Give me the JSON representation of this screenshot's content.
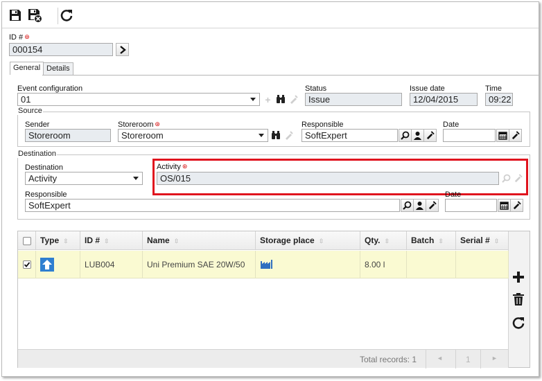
{
  "toolbar": {
    "save_icon": "save-icon",
    "save_close_icon": "save-and-close-icon",
    "refresh_icon": "refresh-icon"
  },
  "header": {
    "id_label": "ID #",
    "id_value": "000154"
  },
  "tabs": [
    {
      "label": "General",
      "active": true
    },
    {
      "label": "Details",
      "active": false
    }
  ],
  "event": {
    "config_label": "Event configuration",
    "config_value": "01",
    "status_label": "Status",
    "status_value": "Issue",
    "issue_date_label": "Issue date",
    "issue_date_value": "12/04/2015",
    "time_label": "Time",
    "time_value": "09:22"
  },
  "source": {
    "legend": "Source",
    "sender_label": "Sender",
    "sender_value": "Storeroom",
    "storeroom_label": "Storeroom",
    "storeroom_value": "Storeroom",
    "responsible_label": "Responsible",
    "responsible_value": "SoftExpert",
    "date_label": "Date",
    "date_value": ""
  },
  "destination": {
    "legend": "Destination",
    "dest_label": "Destination",
    "dest_value": "Activity",
    "activity_label": "Activity",
    "activity_value": "OS/015",
    "responsible_label": "Responsible",
    "responsible_value": "SoftExpert",
    "date_label": "Date",
    "date_value": ""
  },
  "grid": {
    "columns": [
      "Type",
      "ID #",
      "Name",
      "Storage place",
      "Qty.",
      "Batch",
      "Serial #"
    ],
    "rows": [
      {
        "checked": true,
        "type_icon": "inbound-type-icon",
        "id": "LUB004",
        "name": "Uni Premium SAE 20W/50",
        "storage_icon": "factory-icon",
        "qty": "8.00 l",
        "batch": "",
        "serial": ""
      }
    ],
    "footer": {
      "total_records": "Total records: 1",
      "prev": "◄",
      "page": "1",
      "next": "►"
    }
  },
  "side_actions": {
    "add_icon": "plus-icon",
    "delete_icon": "trash-icon",
    "refresh_icon": "refresh-icon"
  },
  "colors": {
    "highlight_border": "#e0141e",
    "row_highlight": "#fafad2",
    "readonly_field": "#e8ecf0",
    "required_marker": "#d40000"
  }
}
